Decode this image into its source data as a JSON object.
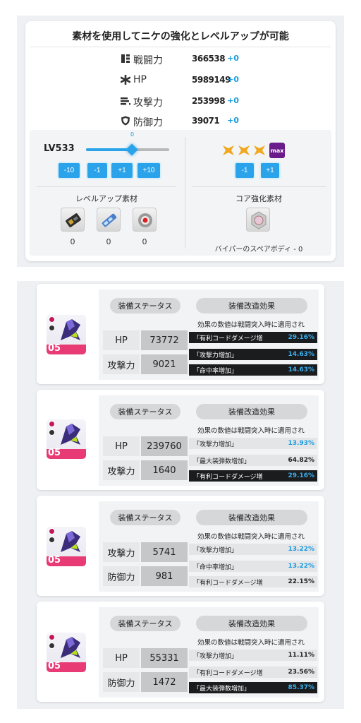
{
  "upgrade": {
    "title": "素材を使用してニケの強化とレベルアップが可能",
    "stats": [
      {
        "icon": "combat-power-icon",
        "label": "戦闘力",
        "value": "366538",
        "delta": "+0"
      },
      {
        "icon": "hp-icon",
        "label": "HP",
        "value": "5989149",
        "delta": "+0"
      },
      {
        "icon": "attack-icon",
        "label": "攻撃力",
        "value": "253998",
        "delta": "+0"
      },
      {
        "icon": "defense-icon",
        "label": "防御力",
        "value": "39071",
        "delta": "+0"
      }
    ],
    "level": {
      "label": "LV533",
      "slider_value": "0",
      "slider_fraction": 0.55,
      "buttons": [
        "-10",
        "-1",
        "+1",
        "+10"
      ]
    },
    "level_materials": {
      "title": "レベルアップ素材",
      "items": [
        {
          "icon": "battle-data-icon",
          "count": "0"
        },
        {
          "icon": "battle-drive-icon",
          "count": "0"
        },
        {
          "icon": "core-dust-icon",
          "count": "0"
        }
      ]
    },
    "core": {
      "stars": 3,
      "max_label": "max",
      "buttons": [
        "-1",
        "+1"
      ],
      "title": "コア強化素材",
      "item_icon": "spare-body-icon",
      "caption": "バイパーのスペアボディ - 0"
    }
  },
  "equipment_common": {
    "status_tab": "装備ステータス",
    "effect_tab": "装備改造効果",
    "note": "効果の数値は戦闘突入時に適用され"
  },
  "equipment": [
    {
      "tier": "05",
      "stats": [
        {
          "label": "HP",
          "value": "73772"
        },
        {
          "label": "攻撃力",
          "value": "9021"
        }
      ],
      "effects": [
        {
          "name": "「有利コードダメージ増",
          "value": "29.16%",
          "style": "dark"
        },
        {
          "name": "「攻撃力増加」",
          "value": "14.63%",
          "style": "dark"
        },
        {
          "name": "「命中率増加」",
          "value": "14.63%",
          "style": "dark"
        }
      ]
    },
    {
      "tier": "05",
      "stats": [
        {
          "label": "HP",
          "value": "239760"
        },
        {
          "label": "攻撃力",
          "value": "1640"
        }
      ],
      "effects": [
        {
          "name": "「攻撃力増加」",
          "value": "13.93%",
          "style": "light"
        },
        {
          "name": "「最大装弾数増加」",
          "value": "64.82%",
          "style": "plain"
        },
        {
          "name": "「有利コードダメージ増",
          "value": "29.16%",
          "style": "dark"
        }
      ]
    },
    {
      "tier": "05",
      "stats": [
        {
          "label": "攻撃力",
          "value": "5741"
        },
        {
          "label": "防御力",
          "value": "981"
        }
      ],
      "effects": [
        {
          "name": "「攻撃力増加」",
          "value": "13.22%",
          "style": "light"
        },
        {
          "name": "「命中率増加」",
          "value": "13.22%",
          "style": "light"
        },
        {
          "name": "「有利コードダメージ増",
          "value": "22.15%",
          "style": "plain"
        }
      ]
    },
    {
      "tier": "05",
      "stats": [
        {
          "label": "HP",
          "value": "55331"
        },
        {
          "label": "防御力",
          "value": "1472"
        }
      ],
      "effects": [
        {
          "name": "「攻撃力増加」",
          "value": "11.11%",
          "style": "plain"
        },
        {
          "name": "「有利コードダメージ増",
          "value": "23.56%",
          "style": "plain"
        },
        {
          "name": "「最大装弾数増加」",
          "value": "85.37%",
          "style": "dark"
        }
      ]
    }
  ]
}
